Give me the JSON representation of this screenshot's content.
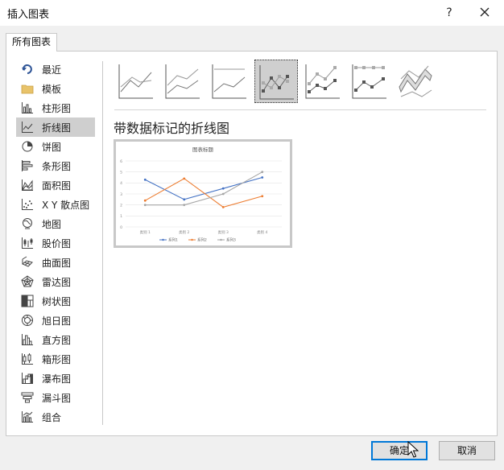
{
  "window": {
    "title": "插入图表",
    "help_label": "?"
  },
  "tab": {
    "label": "所有图表"
  },
  "sidebar": {
    "items": [
      {
        "label": "最近",
        "icon": "recent-icon"
      },
      {
        "label": "模板",
        "icon": "folder-icon"
      },
      {
        "label": "柱形图",
        "icon": "column-chart-icon"
      },
      {
        "label": "折线图",
        "icon": "line-chart-icon",
        "selected": true
      },
      {
        "label": "饼图",
        "icon": "pie-chart-icon"
      },
      {
        "label": "条形图",
        "icon": "bar-chart-icon"
      },
      {
        "label": "面积图",
        "icon": "area-chart-icon"
      },
      {
        "label": "X Y 散点图",
        "icon": "scatter-chart-icon"
      },
      {
        "label": "地图",
        "icon": "map-chart-icon"
      },
      {
        "label": "股价图",
        "icon": "stock-chart-icon"
      },
      {
        "label": "曲面图",
        "icon": "surface-chart-icon"
      },
      {
        "label": "雷达图",
        "icon": "radar-chart-icon"
      },
      {
        "label": "树状图",
        "icon": "treemap-chart-icon"
      },
      {
        "label": "旭日图",
        "icon": "sunburst-chart-icon"
      },
      {
        "label": "直方图",
        "icon": "histogram-chart-icon"
      },
      {
        "label": "箱形图",
        "icon": "box-whisker-chart-icon"
      },
      {
        "label": "瀑布图",
        "icon": "waterfall-chart-icon"
      },
      {
        "label": "漏斗图",
        "icon": "funnel-chart-icon"
      },
      {
        "label": "组合",
        "icon": "combo-chart-icon"
      }
    ]
  },
  "chart_types": [
    {
      "icon": "line-subtype-icon"
    },
    {
      "icon": "stacked-line-subtype-icon"
    },
    {
      "icon": "percent-stacked-line-subtype-icon"
    },
    {
      "icon": "line-with-markers-subtype-icon",
      "selected": true
    },
    {
      "icon": "stacked-line-markers-subtype-icon"
    },
    {
      "icon": "percent-stacked-line-markers-subtype-icon"
    },
    {
      "icon": "3d-line-subtype-icon"
    }
  ],
  "selected_type_label": "带数据标记的折线图",
  "chart_data": {
    "type": "line",
    "title": "图表标题",
    "categories": [
      "类别 1",
      "类别 2",
      "类别 3",
      "类别 4"
    ],
    "ylim": [
      0,
      6
    ],
    "yticks": [
      "0",
      "1",
      "2",
      "3",
      "4",
      "5",
      "6"
    ],
    "series": [
      {
        "name": "系列1",
        "values": [
          4.3,
          2.5,
          3.5,
          4.5
        ],
        "color": "#4472c4"
      },
      {
        "name": "系列2",
        "values": [
          2.4,
          4.4,
          1.8,
          2.8
        ],
        "color": "#ed7d31"
      },
      {
        "name": "系列3",
        "values": [
          2.0,
          2.0,
          3.0,
          5.0
        ],
        "color": "#a5a5a5"
      }
    ],
    "markers": true,
    "grid": true,
    "legend": "bottom"
  },
  "buttons": {
    "ok": "确定",
    "cancel": "取消"
  }
}
